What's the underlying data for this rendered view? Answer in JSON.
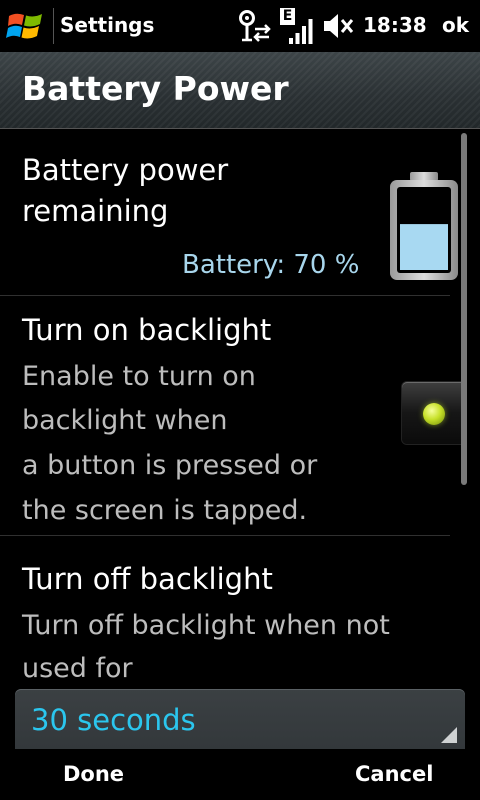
{
  "status_bar": {
    "app_title": "Settings",
    "time": "18:38",
    "ok_label": "ok",
    "network_type": "E",
    "icons": [
      "windows-start-icon",
      "connectivity-icon",
      "signal-strength-icon",
      "speaker-muted-icon"
    ]
  },
  "header": {
    "title": "Battery Power"
  },
  "battery": {
    "label_line1": "Battery power",
    "label_line2": "remaining",
    "status_text": "Battery: 70 %",
    "level_percent": 70,
    "fill_color": "#a8d9f2"
  },
  "backlight_on": {
    "title": "Turn on backlight",
    "desc_lines": [
      "Enable to turn on",
      "backlight when",
      "a button is pressed or",
      "the screen is tapped."
    ],
    "enabled": true,
    "led_color": "#c7e12a"
  },
  "backlight_off": {
    "title": "Turn off backlight",
    "desc_lines": [
      "Turn off backlight when not",
      "used for"
    ],
    "selected_value": "30 seconds",
    "value_color": "#2bc6ee"
  },
  "softkeys": {
    "left": "Done",
    "right": "Cancel"
  }
}
